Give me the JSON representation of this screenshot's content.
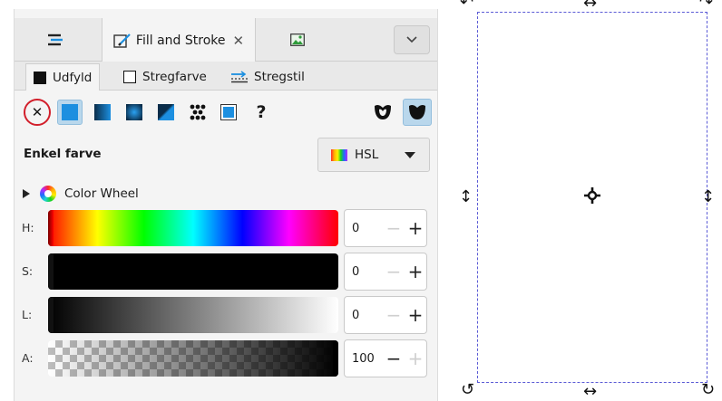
{
  "dock_tabs": [
    {
      "icon": "layers-icon"
    },
    {
      "label": "Fill and Stroke",
      "close": "✕",
      "icon": "fill-stroke-icon"
    },
    {
      "icon": "image-icon"
    }
  ],
  "dock_dropdown_icon": "chevron-down-icon",
  "subtabs": [
    {
      "label": "Udfyld",
      "icon": "fill-swatch-icon"
    },
    {
      "label": "Stregfarve",
      "icon": "stroke-swatch-icon"
    },
    {
      "label": "Stregstil",
      "icon": "stroke-style-icon"
    }
  ],
  "paint_types": [
    "none",
    "flat",
    "linear",
    "radial",
    "mesh",
    "pattern",
    "swatch",
    "unset"
  ],
  "paint_unset_label": "?",
  "mode_label": "Enkel farve",
  "color_mode": {
    "value": "HSL"
  },
  "color_wheel_label": "Color Wheel",
  "sliders": [
    {
      "label": "H:",
      "value": "0"
    },
    {
      "label": "S:",
      "value": "0"
    },
    {
      "label": "L:",
      "value": "0"
    },
    {
      "label": "A:",
      "value": "100"
    }
  ],
  "spin_minus": "−",
  "spin_plus": "+",
  "colors": {
    "accent": "#1c8fe0",
    "selection": "#5b5bd6",
    "none_ring": "#d21f2b"
  }
}
